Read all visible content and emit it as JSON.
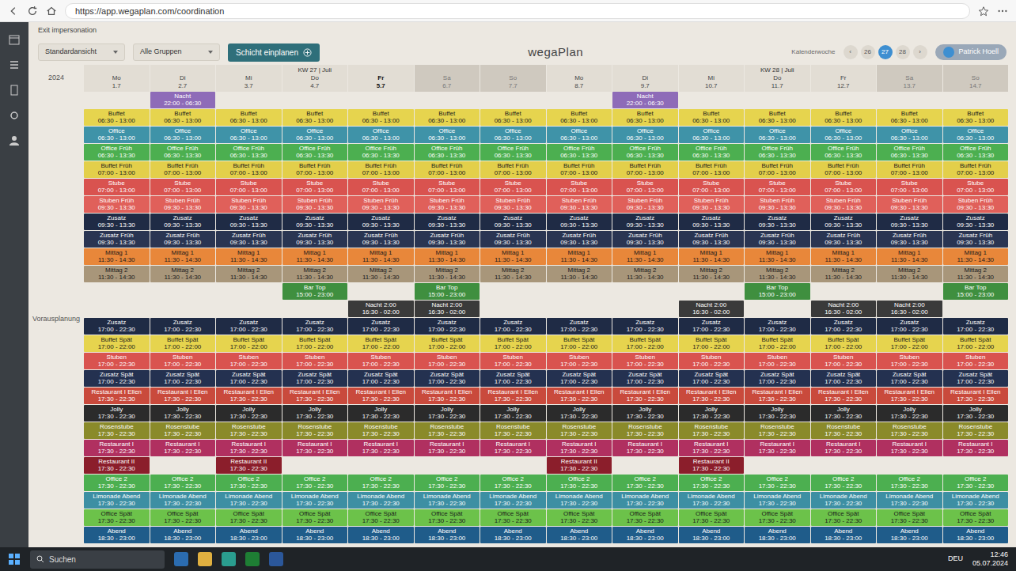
{
  "browser": {
    "url": "https://app.wegaplan.com/coordination"
  },
  "app": {
    "exit": "Exit impersonation",
    "title": "wegaPlan",
    "view": "Standardansicht",
    "groups": "Alle Gruppen",
    "action": "Schicht einplanen",
    "user": "Patrick Hoell",
    "year": "2024",
    "week_label": "Kalenderwoche",
    "prev": "‹",
    "next": "›",
    "weeks": [
      {
        "label": "26",
        "selected": false
      },
      {
        "label": "27",
        "selected": true
      },
      {
        "label": "28",
        "selected": false
      }
    ]
  },
  "section_label": "Vorausplanung",
  "days": [
    {
      "weekday": "Mo",
      "date": "1.7",
      "kw": "",
      "today": false,
      "weekend": false
    },
    {
      "weekday": "Di",
      "date": "2.7",
      "kw": "",
      "today": false,
      "weekend": false
    },
    {
      "weekday": "Mi",
      "date": "3.7",
      "kw": "",
      "today": false,
      "weekend": false
    },
    {
      "weekday": "Do",
      "date": "4.7",
      "kw": "KW 27 | Juli",
      "today": false,
      "weekend": false
    },
    {
      "weekday": "Fr",
      "date": "5.7",
      "kw": "",
      "today": true,
      "weekend": false
    },
    {
      "weekday": "Sa",
      "date": "6.7",
      "kw": "",
      "today": false,
      "weekend": true
    },
    {
      "weekday": "So",
      "date": "7.7",
      "kw": "",
      "today": false,
      "weekend": true
    },
    {
      "weekday": "Mo",
      "date": "8.7",
      "kw": "",
      "today": false,
      "weekend": false
    },
    {
      "weekday": "Di",
      "date": "9.7",
      "kw": "",
      "today": false,
      "weekend": false
    },
    {
      "weekday": "Mi",
      "date": "10.7",
      "kw": "",
      "today": false,
      "weekend": false
    },
    {
      "weekday": "Do",
      "date": "11.7",
      "kw": "KW 28 | Juli",
      "today": false,
      "weekend": false
    },
    {
      "weekday": "Fr",
      "date": "12.7",
      "kw": "",
      "today": false,
      "weekend": false
    },
    {
      "weekday": "Sa",
      "date": "13.7",
      "kw": "",
      "today": false,
      "weekend": true
    },
    {
      "weekday": "So",
      "date": "14.7",
      "kw": "",
      "today": false,
      "weekend": true
    }
  ],
  "rows": [
    {
      "label": "Nacht",
      "time": "22:00 - 06:30",
      "color": "#8e6bb8",
      "present": [
        false,
        true,
        false,
        false,
        false,
        false,
        false,
        false,
        true,
        false,
        false,
        false,
        false,
        false
      ]
    },
    {
      "label": "Buffet",
      "time": "06:30 - 13:00",
      "color": "#e6d44e",
      "present": [
        true,
        true,
        true,
        true,
        true,
        true,
        true,
        true,
        true,
        true,
        true,
        true,
        true,
        true
      ]
    },
    {
      "label": "Office",
      "time": "06:30 - 13:00",
      "color": "#3f93a8",
      "present": [
        true,
        true,
        true,
        true,
        true,
        true,
        true,
        true,
        true,
        true,
        true,
        true,
        true,
        true
      ]
    },
    {
      "label": "Office Früh",
      "time": "06:30 - 13:30",
      "color": "#4caf50",
      "present": [
        true,
        true,
        true,
        true,
        true,
        true,
        true,
        true,
        true,
        true,
        true,
        true,
        true,
        true
      ]
    },
    {
      "label": "Buffet Früh",
      "time": "07:00 - 13:00",
      "color": "#e3cf4a",
      "present": [
        true,
        true,
        true,
        true,
        true,
        true,
        true,
        true,
        true,
        true,
        true,
        true,
        true,
        true
      ]
    },
    {
      "label": "Stube",
      "time": "07:00 - 13:00",
      "color": "#d9534f",
      "present": [
        true,
        true,
        true,
        true,
        true,
        true,
        true,
        true,
        true,
        true,
        true,
        true,
        true,
        true
      ]
    },
    {
      "label": "Stuben Früh",
      "time": "09:30 - 13:30",
      "color": "#e0605a",
      "present": [
        true,
        true,
        true,
        true,
        true,
        true,
        true,
        true,
        true,
        true,
        true,
        true,
        true,
        true
      ]
    },
    {
      "label": "Zusatz",
      "time": "09:30 - 13:30",
      "color": "#1f2b45",
      "present": [
        true,
        true,
        true,
        true,
        true,
        true,
        true,
        true,
        true,
        true,
        true,
        true,
        true,
        true
      ]
    },
    {
      "label": "Zusatz Früh",
      "time": "09:30 - 13:30",
      "color": "#2a3552",
      "present": [
        true,
        true,
        true,
        true,
        true,
        true,
        true,
        true,
        true,
        true,
        true,
        true,
        true,
        true
      ]
    },
    {
      "label": "Mittag 1",
      "time": "11:30 - 14:30",
      "color": "#e8873a",
      "present": [
        true,
        true,
        true,
        true,
        true,
        true,
        true,
        true,
        true,
        true,
        true,
        true,
        true,
        true
      ]
    },
    {
      "label": "Mittag 2",
      "time": "11:30 - 14:30",
      "color": "#a8967a",
      "present": [
        true,
        true,
        true,
        true,
        true,
        true,
        true,
        true,
        true,
        true,
        true,
        true,
        true,
        true
      ]
    },
    {
      "label": "Bar Top",
      "time": "15:00 - 23:00",
      "color": "#3f8f3f",
      "present": [
        false,
        false,
        false,
        true,
        false,
        true,
        false,
        false,
        false,
        false,
        true,
        false,
        false,
        true
      ]
    },
    {
      "label": "Nacht 2:00",
      "time": "16:30 - 02:00",
      "color": "#3a3a3a",
      "present": [
        false,
        false,
        false,
        false,
        true,
        true,
        false,
        false,
        false,
        true,
        false,
        true,
        true,
        false
      ]
    },
    {
      "label": "Zusatz",
      "time": "17:00 - 22:30",
      "color": "#1f2b45",
      "present": [
        true,
        true,
        true,
        true,
        true,
        true,
        true,
        true,
        true,
        true,
        true,
        true,
        true,
        true
      ]
    },
    {
      "label": "Buffet Spät",
      "time": "17:00 - 22:00",
      "color": "#e6d44e",
      "present": [
        true,
        true,
        true,
        true,
        true,
        true,
        true,
        true,
        true,
        true,
        true,
        true,
        true,
        true
      ]
    },
    {
      "label": "Stuben",
      "time": "17:00 - 22:30",
      "color": "#d9534f",
      "present": [
        true,
        true,
        true,
        true,
        true,
        true,
        true,
        true,
        true,
        true,
        true,
        true,
        true,
        true
      ]
    },
    {
      "label": "Zusatz Spät",
      "time": "17:00 - 22:30",
      "color": "#243150",
      "present": [
        true,
        true,
        true,
        true,
        true,
        true,
        true,
        true,
        true,
        true,
        true,
        true,
        true,
        true
      ]
    },
    {
      "label": "Restaurant I Ellen",
      "time": "17:30 - 22:30",
      "color": "#c94a3c",
      "present": [
        true,
        true,
        true,
        true,
        true,
        true,
        true,
        true,
        true,
        true,
        true,
        true,
        true,
        true
      ]
    },
    {
      "label": "Jolly",
      "time": "17:30 - 22:30",
      "color": "#2b2b2b",
      "present": [
        true,
        true,
        true,
        true,
        true,
        true,
        true,
        true,
        true,
        true,
        true,
        true,
        true,
        true
      ]
    },
    {
      "label": "Rosenstube",
      "time": "17:30 - 22:30",
      "color": "#8a8a2a",
      "present": [
        true,
        true,
        true,
        true,
        true,
        true,
        true,
        true,
        true,
        true,
        true,
        true,
        true,
        true
      ]
    },
    {
      "label": "Restaurant I",
      "time": "17:30 - 22:30",
      "color": "#b03060",
      "present": [
        true,
        true,
        true,
        true,
        true,
        true,
        true,
        true,
        true,
        true,
        true,
        true,
        true,
        true
      ]
    },
    {
      "label": "Restaurant II",
      "time": "17:30 - 22:30",
      "color": "#8b1e2b",
      "present": [
        true,
        false,
        true,
        false,
        false,
        false,
        false,
        true,
        false,
        true,
        false,
        false,
        false,
        false
      ]
    },
    {
      "label": "Office 2",
      "time": "17:30 - 22:30",
      "color": "#4caf50",
      "present": [
        true,
        true,
        true,
        true,
        true,
        true,
        true,
        true,
        true,
        true,
        true,
        true,
        true,
        true
      ]
    },
    {
      "label": "Limonade Abend",
      "time": "17:30 - 22:30",
      "color": "#3d8fa3",
      "present": [
        true,
        true,
        true,
        true,
        true,
        true,
        true,
        true,
        true,
        true,
        true,
        true,
        true,
        true
      ]
    },
    {
      "label": "Office Spät",
      "time": "17:30 - 22:30",
      "color": "#6cc24a",
      "present": [
        true,
        true,
        true,
        true,
        true,
        true,
        true,
        true,
        true,
        true,
        true,
        true,
        true,
        true
      ]
    },
    {
      "label": "Abend",
      "time": "18:30 - 23:00",
      "color": "#1f5c8a",
      "present": [
        true,
        true,
        true,
        true,
        true,
        true,
        true,
        true,
        true,
        true,
        true,
        true,
        true,
        true
      ]
    }
  ],
  "taskbar": {
    "search": "Suchen",
    "lang": "DEU",
    "time": "12:46",
    "date": "05.07.2024"
  }
}
